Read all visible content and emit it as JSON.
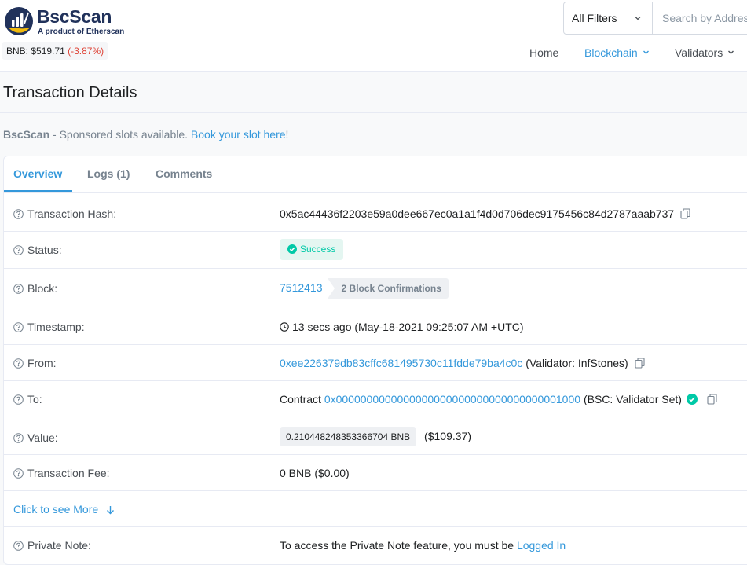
{
  "brand": {
    "name": "BscScan",
    "tagline": "A product of Etherscan",
    "logo_colors": {
      "primary": "#21325b",
      "accent": "#f0b90b"
    }
  },
  "price": {
    "label": "BNB:",
    "value": "$519.71",
    "change": "(-3.87%)"
  },
  "search": {
    "filter_label": "All Filters",
    "placeholder": "Search by Address / Txn Hash / Block / Token"
  },
  "nav": {
    "home": "Home",
    "blockchain": "Blockchain",
    "validators": "Validators"
  },
  "page": {
    "title": "Transaction Details"
  },
  "sponsor": {
    "brand": "BscScan",
    "text": " - Sponsored slots available. ",
    "link": "Book your slot here",
    "suffix": "!"
  },
  "tabs": [
    {
      "label": "Overview",
      "active": true
    },
    {
      "label": "Logs (1)",
      "active": false
    },
    {
      "label": "Comments",
      "active": false
    }
  ],
  "details": {
    "tx_hash": {
      "label": "Transaction Hash:",
      "value": "0x5ac44436f2203e59a0dee667ec0a1a1f4d0d706dec9175456c84d2787aaab737"
    },
    "status": {
      "label": "Status:",
      "value": "Success"
    },
    "block": {
      "label": "Block:",
      "number": "7512413",
      "confirmations": "2 Block Confirmations"
    },
    "timestamp": {
      "label": "Timestamp:",
      "value": "13 secs ago (May-18-2021 09:25:07 AM +UTC)"
    },
    "from": {
      "label": "From:",
      "address": "0xee226379db83cffc681495730c11fdde79ba4c0c",
      "note": "(Validator: InfStones)"
    },
    "to": {
      "label": "To:",
      "prefix": "Contract",
      "address": "0x0000000000000000000000000000000000001000",
      "note": "(BSC: Validator Set)"
    },
    "value": {
      "label": "Value:",
      "amount": "0.210448248353366704 BNB",
      "usd": "($109.37)"
    },
    "fee": {
      "label": "Transaction Fee:",
      "value": "0 BNB ($0.00)"
    },
    "more": {
      "label": "Click to see More"
    },
    "private_note": {
      "label": "Private Note:",
      "text": "To access the Private Note feature, you must be ",
      "link": "Logged In"
    }
  },
  "colors": {
    "link": "#3498db",
    "success": "#00c9a7",
    "success_bg": "#e4f6f1",
    "negative": "#de4437"
  }
}
